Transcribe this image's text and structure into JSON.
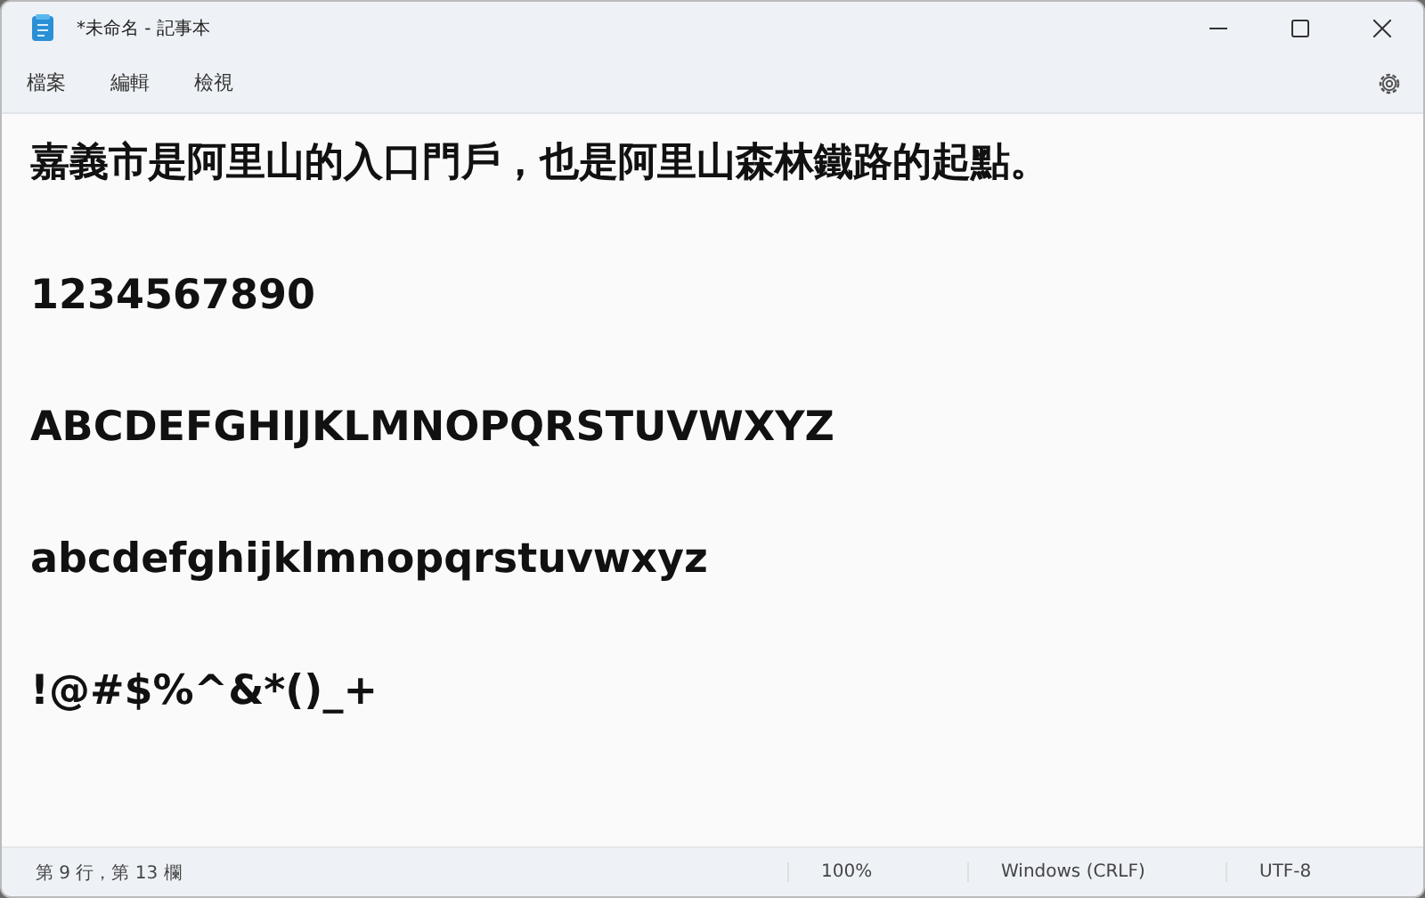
{
  "window": {
    "title": "*未命名 - 記事本"
  },
  "menu": [
    "檔案",
    "編輯",
    "檢視"
  ],
  "editor": {
    "lines": [
      "嘉義市是阿里山的入口門戶，也是阿里山森林鐵路的起點。",
      "1234567890",
      "ABCDEFGHIJKLMNOPQRSTUVWXYZ",
      "abcdefghijklmnopqrstuvwxyz",
      "!@#$%^&*()_+"
    ]
  },
  "status_bar": {
    "position": "第 9 行，第 13 欄",
    "zoom": "100%",
    "line_ending": "Windows (CRLF)",
    "encoding": "UTF-8"
  }
}
